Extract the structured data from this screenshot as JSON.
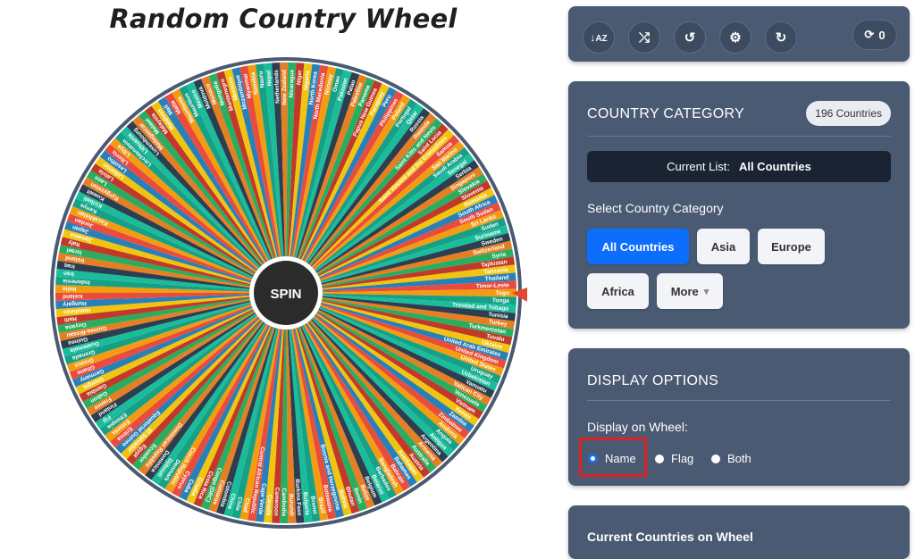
{
  "page": {
    "title": "Random Country Wheel"
  },
  "wheel": {
    "spin_label": "SPIN",
    "visible_labels": [
      "Samoa",
      "San Marino",
      "Saudi Arabia",
      "Senegal",
      "Serbia",
      "Singapore",
      "Slovakia",
      "Slovenia",
      "Romania",
      "South Africa",
      "South Sudan",
      "Sri Lanka",
      "Sudan",
      "Suriname",
      "Sweden",
      "Switzerland",
      "Syria",
      "Tajikistan",
      "Tanzania",
      "Thailand",
      "Timor-Leste",
      "Togo",
      "Tonga",
      "Trinidad and Tobago",
      "Tunisia",
      "Turkey",
      "Turkmenistan",
      "Tuvalu",
      "Ukraine",
      "United Arab Emirates",
      "United Kingdom",
      "United States",
      "Uruguay",
      "Uzbekistan",
      "Vanuatu",
      "Vatican City",
      "Venezuela",
      "Vietnam",
      "Yemen",
      "Zambia",
      "Zimbabwe",
      "Andorra",
      "Angola",
      "Antigua",
      "Argentina",
      "Armenia",
      "Australia",
      "Austria",
      "Azerbaijan",
      "Bahamas",
      "Bahrain",
      "Bangladesh",
      "Barbados",
      "Belarus",
      "Belgium",
      "Belize",
      "Benin",
      "Bhutan",
      "Bolivia",
      "Bosnia and Herzegovina",
      "Botswana",
      "Brazil",
      "Brunei",
      "Bulgaria",
      "Burkina Faso",
      "Burundi",
      "Cambodia",
      "Cameroon",
      "Canada",
      "Cape Verde",
      "Central African Republic",
      "Chad",
      "Chile",
      "China",
      "Colombia",
      "Comoros",
      "Congo (DRC)",
      "Costa Rica",
      "Croatia",
      "Cuba",
      "Cyprus",
      "Czech Republic",
      "Denmark",
      "Djibouti",
      "Dominica",
      "Dominican Republic",
      "Ecuador",
      "Egypt",
      "El Salvador",
      "Equatorial Guinea",
      "Eritrea",
      "Estonia",
      "Ethiopia",
      "Fiji",
      "Finland",
      "France",
      "Gabon",
      "Gambia",
      "Georgia",
      "Germany",
      "Ghana",
      "Greece",
      "Grenada",
      "Guatemala",
      "Guinea",
      "Guinea-Bissau",
      "Guyana",
      "Haiti",
      "Honduras",
      "Hungary",
      "Iceland",
      "India",
      "Indonesia",
      "Iran",
      "Iraq",
      "Ireland",
      "Israel",
      "Italy",
      "Jamaica",
      "Japan",
      "Jordan",
      "Kazakhstan",
      "Kenya",
      "Kiribati",
      "Kuwait",
      "Kyrgyzstan",
      "Laos",
      "Latvia",
      "Lebanon",
      "Lesotho",
      "Liberia",
      "Libya",
      "Liechtenstein",
      "Lithuania",
      "Luxembourg",
      "Madagascar",
      "Malawi",
      "Malaysia",
      "Maldives",
      "Mali",
      "Malta",
      "Mauritania",
      "Mauritius",
      "Mexico",
      "Moldova",
      "Monaco",
      "Mongolia",
      "Montenegro",
      "Morocco",
      "Mozambique",
      "Myanmar",
      "Namibia",
      "Nauru",
      "Nepal",
      "Netherlands",
      "New Zealand",
      "Nicaragua",
      "Niger",
      "Nigeria",
      "North Korea",
      "North Macedonia",
      "Norway",
      "Oman",
      "Pakistan",
      "Palau",
      "Palestine",
      "Panama",
      "Papua New Guinea",
      "Paraguay",
      "Peru",
      "Philippines",
      "Poland",
      "Portugal",
      "Qatar",
      "Russia",
      "Rwanda",
      "Saint Kitts and Nevis",
      "Saint Lucia",
      "Saint Vincent and the Grenadines"
    ],
    "colors": [
      "#e94b3c",
      "#f39c12",
      "#16a085",
      "#1abc9c",
      "#2c3e50",
      "#e67e22",
      "#27ae60",
      "#c0392b",
      "#f1c40f",
      "#2980b9"
    ]
  },
  "toolbar": {
    "sort_icon": "sort-alpha-icon",
    "shuffle_icon": "shuffle-icon",
    "history_icon": "history-icon",
    "settings_icon": "gear-icon",
    "reset_icon": "redo-icon",
    "spin_count": "0"
  },
  "category": {
    "heading": "COUNTRY CATEGORY",
    "count_badge": "196 Countries",
    "current_list_label": "Current List:",
    "current_list_value": "All Countries",
    "select_label": "Select Country Category",
    "buttons": [
      "All Countries",
      "Asia",
      "Europe",
      "Africa",
      "More"
    ],
    "more_caret": "▾"
  },
  "display": {
    "heading": "DISPLAY OPTIONS",
    "label": "Display on Wheel:",
    "options": [
      "Name",
      "Flag",
      "Both"
    ],
    "selected": "Name"
  },
  "current": {
    "heading": "Current Countries on Wheel"
  },
  "colors": {
    "accent": "#0d6efd",
    "panel": "#4a5a73",
    "highlight": "#dd2222",
    "pointer": "#e3482d"
  }
}
